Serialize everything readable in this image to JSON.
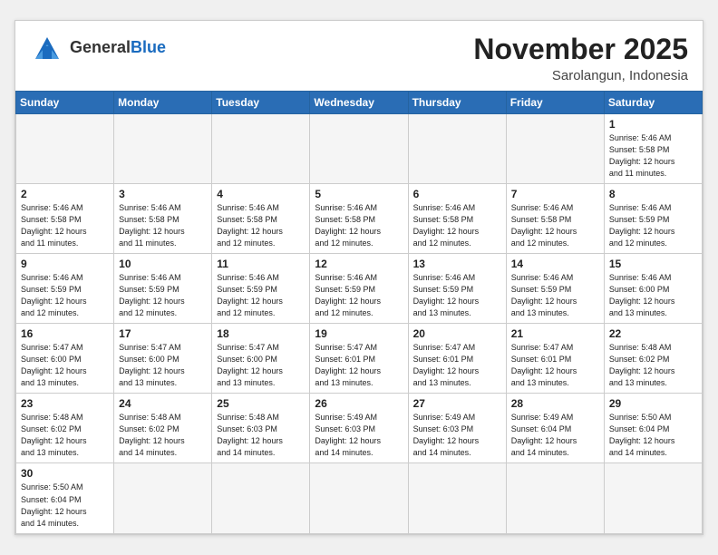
{
  "header": {
    "logo_general": "General",
    "logo_blue": "Blue",
    "month_title": "November 2025",
    "location": "Sarolangun, Indonesia"
  },
  "weekdays": [
    "Sunday",
    "Monday",
    "Tuesday",
    "Wednesday",
    "Thursday",
    "Friday",
    "Saturday"
  ],
  "weeks": [
    [
      {
        "day": "",
        "info": ""
      },
      {
        "day": "",
        "info": ""
      },
      {
        "day": "",
        "info": ""
      },
      {
        "day": "",
        "info": ""
      },
      {
        "day": "",
        "info": ""
      },
      {
        "day": "",
        "info": ""
      },
      {
        "day": "1",
        "info": "Sunrise: 5:46 AM\nSunset: 5:58 PM\nDaylight: 12 hours\nand 11 minutes."
      }
    ],
    [
      {
        "day": "2",
        "info": "Sunrise: 5:46 AM\nSunset: 5:58 PM\nDaylight: 12 hours\nand 11 minutes."
      },
      {
        "day": "3",
        "info": "Sunrise: 5:46 AM\nSunset: 5:58 PM\nDaylight: 12 hours\nand 11 minutes."
      },
      {
        "day": "4",
        "info": "Sunrise: 5:46 AM\nSunset: 5:58 PM\nDaylight: 12 hours\nand 12 minutes."
      },
      {
        "day": "5",
        "info": "Sunrise: 5:46 AM\nSunset: 5:58 PM\nDaylight: 12 hours\nand 12 minutes."
      },
      {
        "day": "6",
        "info": "Sunrise: 5:46 AM\nSunset: 5:58 PM\nDaylight: 12 hours\nand 12 minutes."
      },
      {
        "day": "7",
        "info": "Sunrise: 5:46 AM\nSunset: 5:58 PM\nDaylight: 12 hours\nand 12 minutes."
      },
      {
        "day": "8",
        "info": "Sunrise: 5:46 AM\nSunset: 5:59 PM\nDaylight: 12 hours\nand 12 minutes."
      }
    ],
    [
      {
        "day": "9",
        "info": "Sunrise: 5:46 AM\nSunset: 5:59 PM\nDaylight: 12 hours\nand 12 minutes."
      },
      {
        "day": "10",
        "info": "Sunrise: 5:46 AM\nSunset: 5:59 PM\nDaylight: 12 hours\nand 12 minutes."
      },
      {
        "day": "11",
        "info": "Sunrise: 5:46 AM\nSunset: 5:59 PM\nDaylight: 12 hours\nand 12 minutes."
      },
      {
        "day": "12",
        "info": "Sunrise: 5:46 AM\nSunset: 5:59 PM\nDaylight: 12 hours\nand 12 minutes."
      },
      {
        "day": "13",
        "info": "Sunrise: 5:46 AM\nSunset: 5:59 PM\nDaylight: 12 hours\nand 13 minutes."
      },
      {
        "day": "14",
        "info": "Sunrise: 5:46 AM\nSunset: 5:59 PM\nDaylight: 12 hours\nand 13 minutes."
      },
      {
        "day": "15",
        "info": "Sunrise: 5:46 AM\nSunset: 6:00 PM\nDaylight: 12 hours\nand 13 minutes."
      }
    ],
    [
      {
        "day": "16",
        "info": "Sunrise: 5:47 AM\nSunset: 6:00 PM\nDaylight: 12 hours\nand 13 minutes."
      },
      {
        "day": "17",
        "info": "Sunrise: 5:47 AM\nSunset: 6:00 PM\nDaylight: 12 hours\nand 13 minutes."
      },
      {
        "day": "18",
        "info": "Sunrise: 5:47 AM\nSunset: 6:00 PM\nDaylight: 12 hours\nand 13 minutes."
      },
      {
        "day": "19",
        "info": "Sunrise: 5:47 AM\nSunset: 6:01 PM\nDaylight: 12 hours\nand 13 minutes."
      },
      {
        "day": "20",
        "info": "Sunrise: 5:47 AM\nSunset: 6:01 PM\nDaylight: 12 hours\nand 13 minutes."
      },
      {
        "day": "21",
        "info": "Sunrise: 5:47 AM\nSunset: 6:01 PM\nDaylight: 12 hours\nand 13 minutes."
      },
      {
        "day": "22",
        "info": "Sunrise: 5:48 AM\nSunset: 6:02 PM\nDaylight: 12 hours\nand 13 minutes."
      }
    ],
    [
      {
        "day": "23",
        "info": "Sunrise: 5:48 AM\nSunset: 6:02 PM\nDaylight: 12 hours\nand 13 minutes."
      },
      {
        "day": "24",
        "info": "Sunrise: 5:48 AM\nSunset: 6:02 PM\nDaylight: 12 hours\nand 14 minutes."
      },
      {
        "day": "25",
        "info": "Sunrise: 5:48 AM\nSunset: 6:03 PM\nDaylight: 12 hours\nand 14 minutes."
      },
      {
        "day": "26",
        "info": "Sunrise: 5:49 AM\nSunset: 6:03 PM\nDaylight: 12 hours\nand 14 minutes."
      },
      {
        "day": "27",
        "info": "Sunrise: 5:49 AM\nSunset: 6:03 PM\nDaylight: 12 hours\nand 14 minutes."
      },
      {
        "day": "28",
        "info": "Sunrise: 5:49 AM\nSunset: 6:04 PM\nDaylight: 12 hours\nand 14 minutes."
      },
      {
        "day": "29",
        "info": "Sunrise: 5:50 AM\nSunset: 6:04 PM\nDaylight: 12 hours\nand 14 minutes."
      }
    ],
    [
      {
        "day": "30",
        "info": "Sunrise: 5:50 AM\nSunset: 6:04 PM\nDaylight: 12 hours\nand 14 minutes."
      },
      {
        "day": "",
        "info": ""
      },
      {
        "day": "",
        "info": ""
      },
      {
        "day": "",
        "info": ""
      },
      {
        "day": "",
        "info": ""
      },
      {
        "day": "",
        "info": ""
      },
      {
        "day": "",
        "info": ""
      }
    ]
  ]
}
